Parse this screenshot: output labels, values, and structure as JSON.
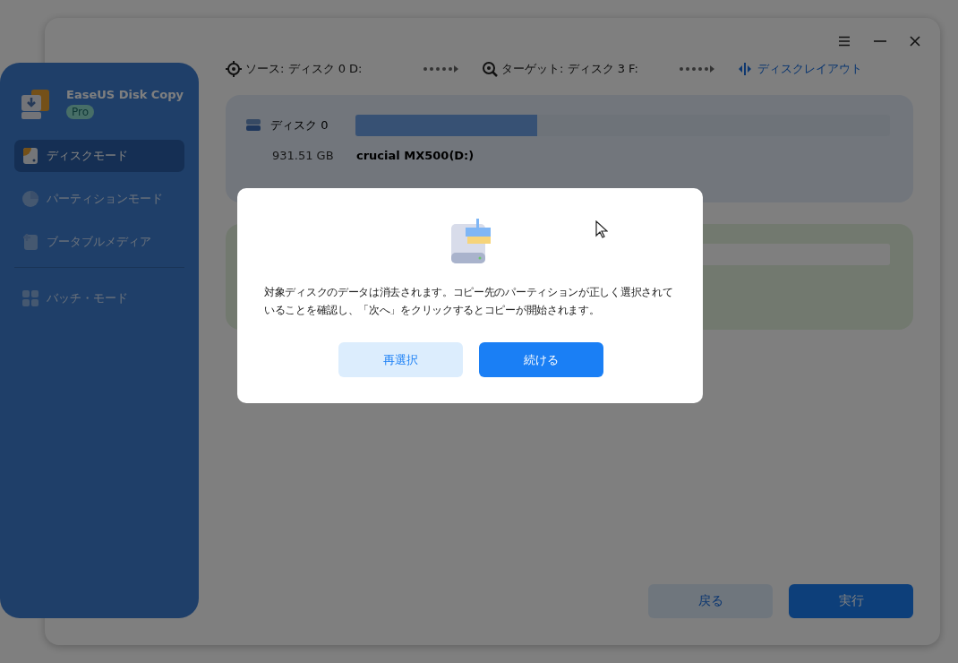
{
  "window_controls": [
    {
      "kind": "menu"
    },
    {
      "kind": "minimize"
    },
    {
      "kind": "close"
    }
  ],
  "sidebar": {
    "app_name": "EaseUS Disk Copy",
    "badge": "Pro",
    "items": [
      {
        "label": "ディスクモード",
        "kind": "disk",
        "selected": true
      },
      {
        "label": "パーティションモード",
        "kind": "partition",
        "selected": false
      },
      {
        "label": "ブータブルメディア",
        "kind": "bootable",
        "selected": false
      },
      {
        "label": "バッチ・モード",
        "kind": "batch",
        "selected": false
      }
    ]
  },
  "header": {
    "source": "ソース: ディスク 0 D:",
    "target": "ターゲット: ディスク 3 F:",
    "layout_link": "ディスクレイアウト"
  },
  "disks": [
    {
      "kind": "source",
      "name": "ディスク 0",
      "size": "931.51 GB",
      "model": "crucial MX500(D:)",
      "level": 0.34
    },
    {
      "kind": "target"
    }
  ],
  "buttons": [
    {
      "label": "戻る",
      "kind": "secondary"
    },
    {
      "label": "実行",
      "kind": "primary"
    }
  ],
  "dialog": {
    "message": "対象ディスクのデータは消去されます。コピー先のパーティションが正しく選択されていることを確認し、「次へ」をクリックするとコピーが開始されます。",
    "buttons": [
      {
        "label": "再選択",
        "kind": "secondary"
      },
      {
        "label": "続ける",
        "kind": "primary"
      }
    ]
  }
}
